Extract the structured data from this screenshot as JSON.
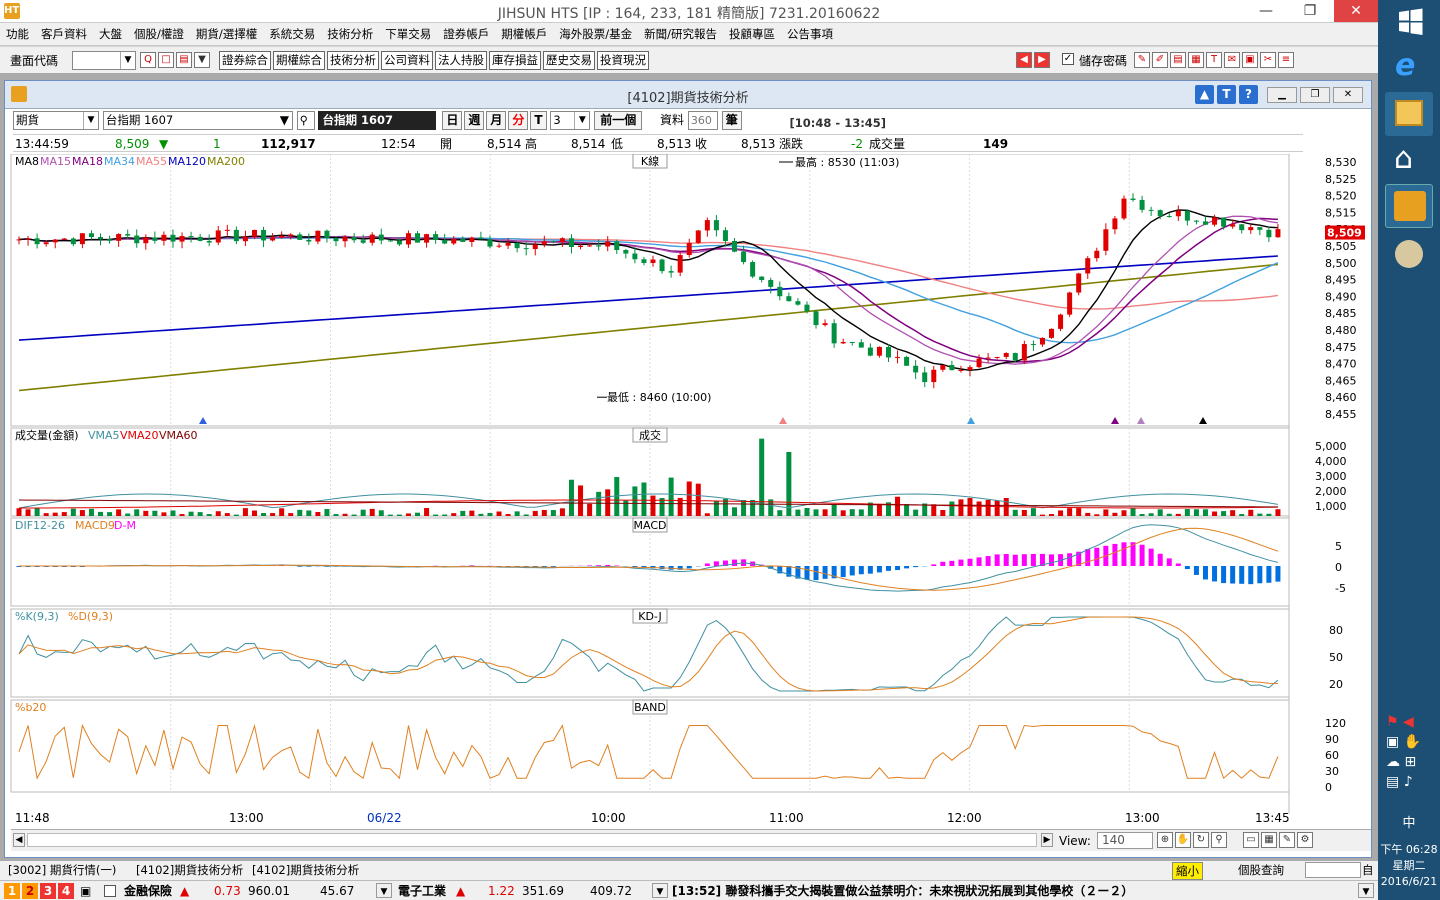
{
  "app": {
    "title": "JIHSUN HTS [IP : 164, 233, 181 精簡版] 7231.20160622",
    "logo": "HTS"
  },
  "menu": [
    "功能",
    "客戶資料",
    "大盤",
    "個股/權證",
    "期貨/選擇權",
    "系統交易",
    "技術分析",
    "下單交易",
    "證券帳戶",
    "期權帳戶",
    "海外股票/基金",
    "新聞/研究報告",
    "投顧專區",
    "公告事項"
  ],
  "toolbar": {
    "code_label": "畫面代碼",
    "buttons": [
      "證券綜合",
      "期權綜合",
      "技術分析",
      "公司資料",
      "法人持股",
      "庫存損益",
      "歷史交易",
      "投資現況"
    ],
    "save_pwd": "儲存密碼"
  },
  "child": {
    "title": "[4102]期貨技術分析",
    "help_btns": [
      "▲",
      "T",
      "?"
    ]
  },
  "controls": {
    "type": "期貨",
    "product": "台指期 1607",
    "product_box": "台指期 1607",
    "periods": [
      "日",
      "週",
      "月",
      "分",
      "T"
    ],
    "active_period": "分",
    "interval": "3",
    "prev": "前一個",
    "data_label": "資料",
    "data_count": "360",
    "unit": "筆",
    "range": "[10:48 - 13:45]"
  },
  "info": {
    "time": "13:44:59",
    "price": "8,509",
    "change_icon": "▼",
    "change": "1",
    "volume_total": "112,917",
    "clock": "12:54",
    "open_l": "開",
    "open": "8,514",
    "high_l": "高",
    "high": "8,514",
    "low_l": "低",
    "low": "8,513",
    "close_l": "收",
    "close": "8,513",
    "chg_l": "漲跌",
    "chg": "-2",
    "vol_l": "成交量",
    "vol": "149"
  },
  "panels": {
    "k_legend": [
      "MA8",
      "MA15",
      "MA18",
      "MA34",
      "MA55",
      "MA120",
      "MA200"
    ],
    "k_title": "K線",
    "high_label": "最高 : 8530 (11:03)",
    "low_label": "最低 : 8460 (10:00)",
    "price_tag": "8,509",
    "vol_legend": [
      "成交量(金額)",
      "VMA5",
      "VMA20",
      "VMA60"
    ],
    "vol_title": "成交",
    "macd_legend": [
      "DIF12-26",
      "MACD9",
      "D-M"
    ],
    "macd_title": "MACD",
    "kd_legend": [
      "%K(9,3)",
      "%D(9,3)"
    ],
    "kd_title": "KD-J",
    "band_legend": [
      "%b20"
    ],
    "band_title": "BAND"
  },
  "colors": {
    "ma8": "#000000",
    "ma15": "#b050b0",
    "ma18": "#800080",
    "ma34": "#40a0e0",
    "ma55": "#f08080",
    "ma120": "#0000c0",
    "ma200": "#808000",
    "up": "#e00000",
    "down": "#009040",
    "dif": "#4090a0",
    "macd": "#e08020",
    "pos": "#ff00ff",
    "neg": "#0070e0"
  },
  "axes": {
    "k_y": [
      "8,530",
      "8,525",
      "8,520",
      "8,515",
      "8,510",
      "8,505",
      "8,500",
      "8,495",
      "8,490",
      "8,485",
      "8,480",
      "8,475",
      "8,470",
      "8,465",
      "8,460",
      "8,455"
    ],
    "vol_y": [
      "5,000",
      "4,000",
      "3,000",
      "2,000",
      "1,000"
    ],
    "macd_y": [
      "5",
      "0",
      "-5"
    ],
    "kd_y": [
      "80",
      "50",
      "20"
    ],
    "band_y": [
      "120",
      "90",
      "60",
      "30",
      "0"
    ],
    "x": [
      "11:48",
      "13:00",
      "06/22",
      "10:00",
      "11:00",
      "12:00",
      "13:00",
      "13:45"
    ]
  },
  "bottom": {
    "view_label": "View:",
    "view": "140"
  },
  "tabs": [
    "[3002] 期貨行情(一)",
    "[4102]期貨技術分析",
    "[4102]期貨技術分析"
  ],
  "tabs_right": {
    "shrink": "縮小",
    "stock_query": "個股查詢",
    "auto": "自"
  },
  "ticker": {
    "pages": [
      "1",
      "2",
      "3",
      "4"
    ],
    "a_name": "金融保險",
    "a_chg": "0.73",
    "a_idx": "960.01",
    "a_vol": "45.67",
    "b_name": "電子工業",
    "b_chg": "1.22",
    "b_idx": "351.69",
    "b_vol": "409.72",
    "news": "[13:52] 聯發科攜手交大揭裝置做公益禁明介：未來視狀況拓展到其他學校（２ー２）"
  },
  "taskbar": {
    "ime": "中",
    "time": "下午 06:28",
    "day": "星期二",
    "date": "2016/6/21"
  },
  "chart_data": {
    "type": "candlestick",
    "title": "K線",
    "y_range": [
      8455,
      8530
    ],
    "high": {
      "value": 8530,
      "time": "11:03"
    },
    "low": {
      "value": 8460,
      "time": "10:00"
    },
    "last": 8509
  }
}
